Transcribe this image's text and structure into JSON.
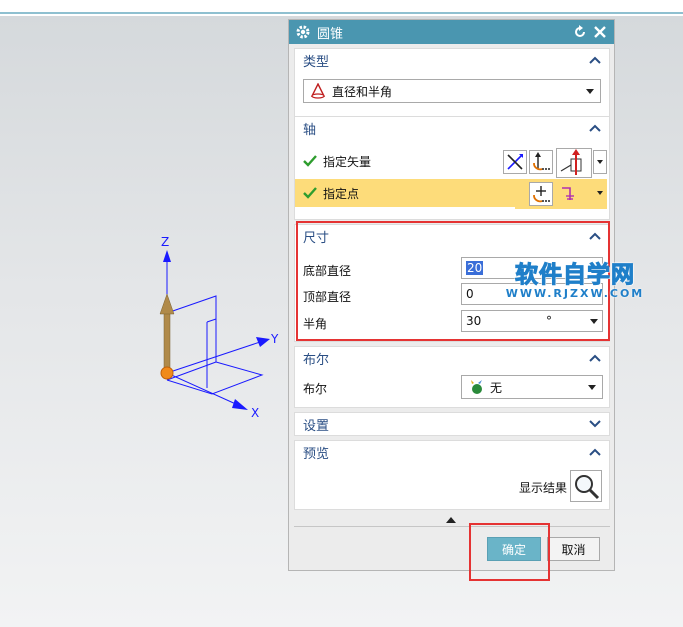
{
  "dialog": {
    "title": "圆锥"
  },
  "type_section": {
    "header": "类型",
    "selected": "直径和半角"
  },
  "axis_section": {
    "header": "轴",
    "vector_label": "指定矢量",
    "point_label": "指定点"
  },
  "dimension_section": {
    "header": "尺寸",
    "base_diameter_label": "底部直径",
    "base_diameter_value": "20",
    "top_diameter_label": "顶部直径",
    "top_diameter_value": "0",
    "half_angle_label": "半角",
    "half_angle_value": "30",
    "half_angle_unit": "°"
  },
  "boolean_section": {
    "header": "布尔",
    "label": "布尔",
    "selected": "无"
  },
  "settings_section": {
    "header": "设置"
  },
  "preview_section": {
    "header": "预览",
    "show_result_label": "显示结果"
  },
  "footer": {
    "ok_label": "确定",
    "cancel_label": "取消"
  },
  "viewport": {
    "axis_z": "Z",
    "axis_y": "Y",
    "axis_x": "X"
  },
  "watermark": {
    "main": "软件自学网",
    "sub": "WWW.RJZXW.COM"
  },
  "colors": {
    "title_bar": "#4a96b0",
    "header_text": "#2a4e84",
    "highlight_row": "#fddc7a",
    "annotation_red": "#e53333",
    "ok_button": "#6ab4c8"
  }
}
